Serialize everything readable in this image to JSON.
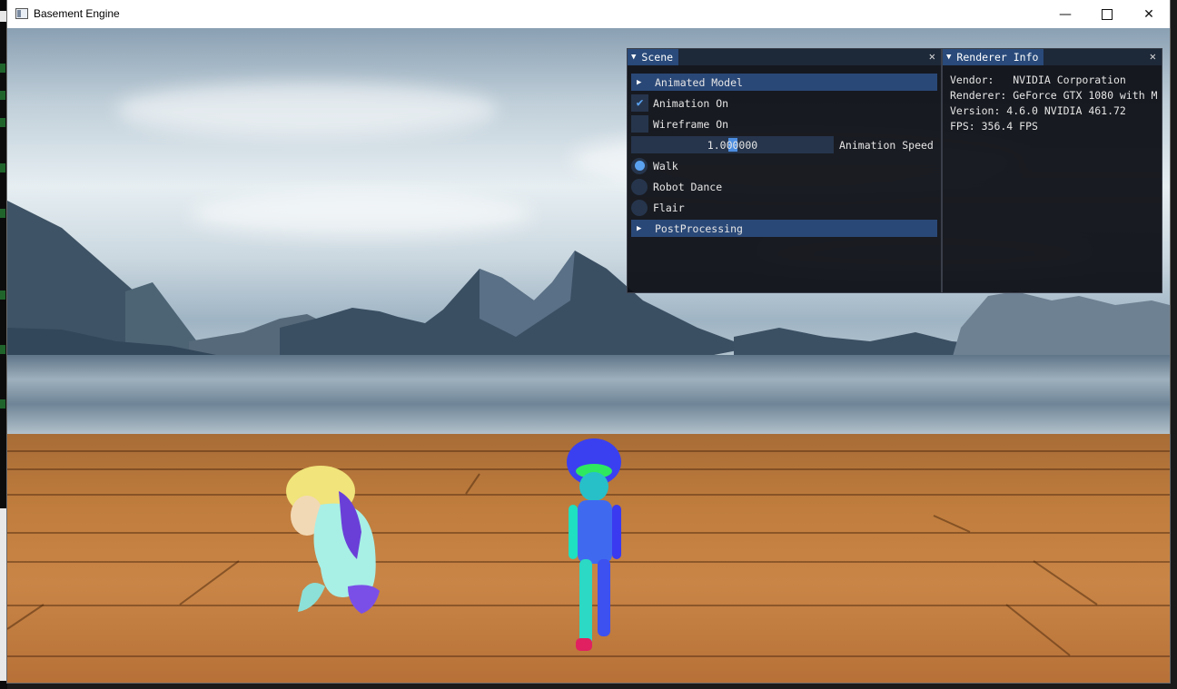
{
  "window": {
    "title": "Basement Engine",
    "minimize_icon": "minimize-icon",
    "maximize_icon": "maximize-icon",
    "close_icon": "close-icon"
  },
  "scene_panel": {
    "title": "Scene",
    "close_icon": "close-icon",
    "header_animated_model": "Animated Model",
    "animation_on": {
      "label": "Animation On",
      "checked": true
    },
    "wireframe_on": {
      "label": "Wireframe On",
      "checked": false
    },
    "animation_speed": {
      "value": "1.000000",
      "label": "Animation Speed"
    },
    "animations": [
      {
        "label": "Walk",
        "selected": true
      },
      {
        "label": "Robot Dance",
        "selected": false
      },
      {
        "label": "Flair",
        "selected": false
      }
    ],
    "header_postprocessing": "PostProcessing"
  },
  "renderer_panel": {
    "title": "Renderer Info",
    "close_icon": "close-icon",
    "lines": [
      "Vendor:   NVIDIA Corporation",
      "Renderer: GeForce GTX 1080 with M",
      "Version: 4.6.0 NVIDIA 461.72",
      "FPS: 356.4 FPS"
    ]
  },
  "colors": {
    "accent": "#5aa2f0",
    "header": "#2a4877",
    "tab_active": "#294a7a"
  }
}
